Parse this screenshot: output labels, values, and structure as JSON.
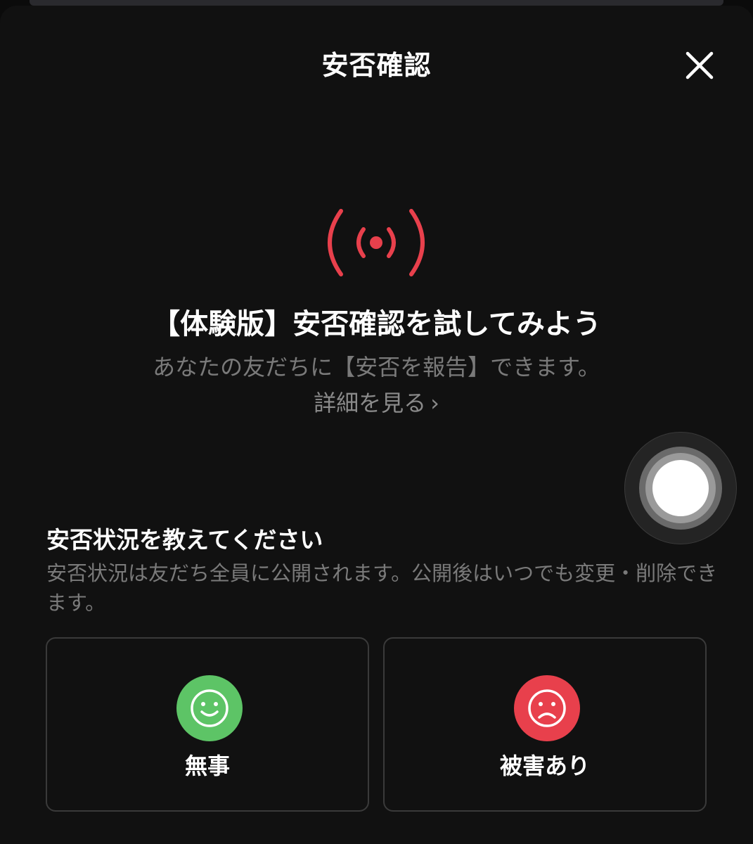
{
  "header": {
    "title": "安否確認",
    "close_icon": "close-icon"
  },
  "hero": {
    "icon": "broadcast-icon",
    "title": "【体験版】安否確認を試してみよう",
    "subtitle": "あなたの友だちに【安否を報告】できます。",
    "details_link": "詳細を見る",
    "details_chevron": "›"
  },
  "status_section": {
    "title": "安否状況を教えてください",
    "description": "安否状況は友だち全員に公開されます。公開後はいつでも変更・削除できます。"
  },
  "options": [
    {
      "label": "無事",
      "icon": "smile-face-icon",
      "color": "#5dc466"
    },
    {
      "label": "被害あり",
      "icon": "frown-face-icon",
      "color": "#e8404c"
    }
  ],
  "colors": {
    "accent_red": "#e8404c",
    "safe_green": "#5dc466",
    "background": "#111111"
  }
}
